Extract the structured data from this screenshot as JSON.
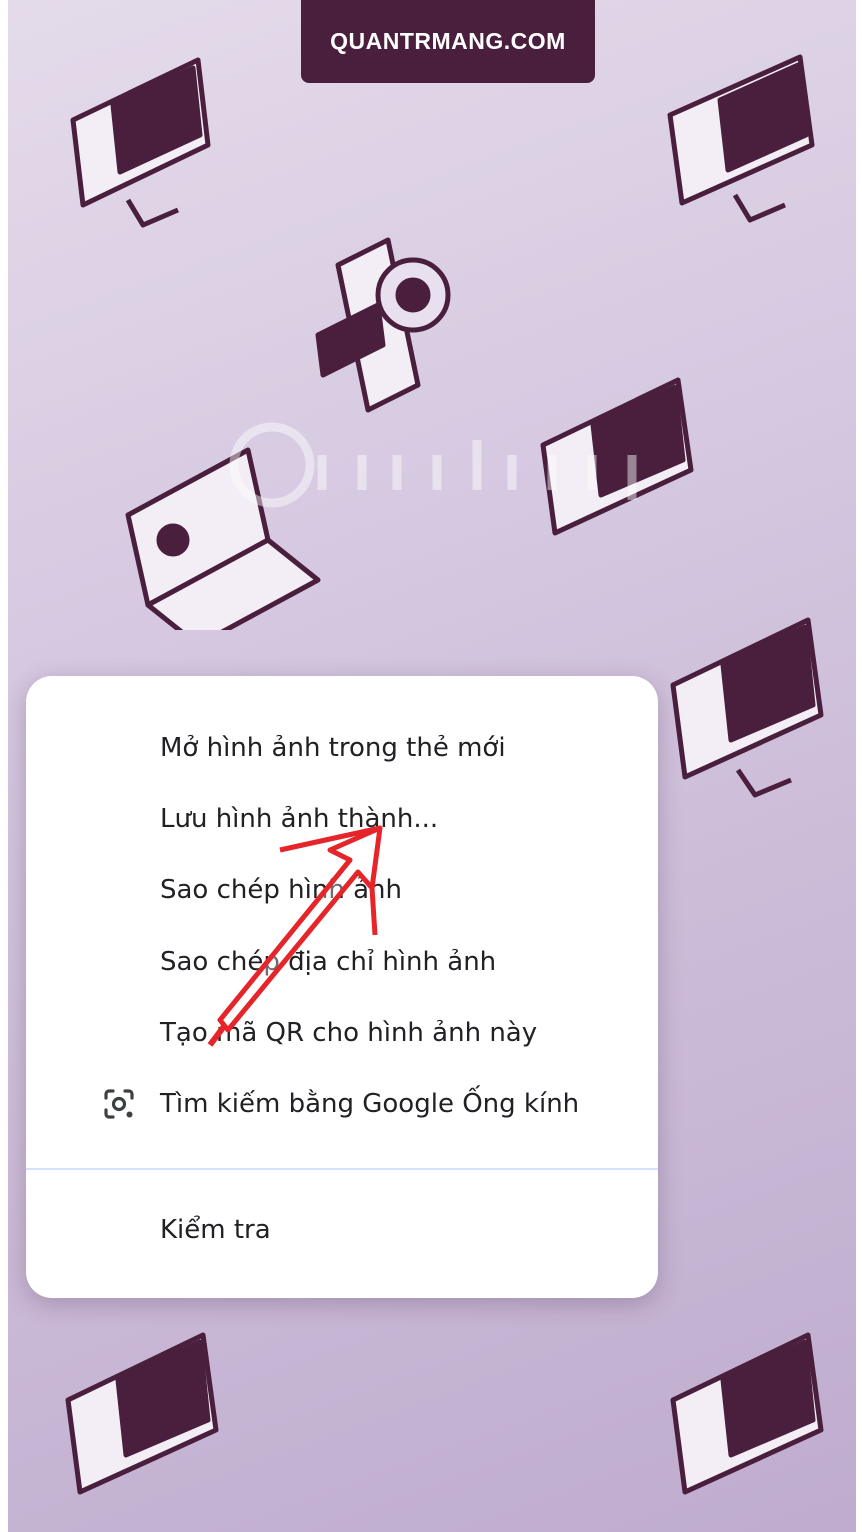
{
  "header": {
    "site_label": "QUANTRMANG.COM"
  },
  "context_menu": {
    "items": [
      {
        "label": "Mở hình ảnh trong thẻ mới"
      },
      {
        "label": "Lưu hình ảnh thành..."
      },
      {
        "label": "Sao chép hình ảnh"
      },
      {
        "label": "Sao chép địa chỉ hình ảnh"
      },
      {
        "label": "Tạo mã QR cho hình ảnh này"
      },
      {
        "label": "Tìm kiếm bằng Google Ống kính",
        "icon": "google-lens-icon"
      },
      {
        "label": "Kiểm tra"
      }
    ]
  },
  "annotation": {
    "icon": "red-arrow-icon",
    "color": "#e5252a"
  },
  "colors": {
    "background": "#d6c9e1",
    "illustration": "#4a1f3d",
    "menu_bg": "#ffffff"
  }
}
